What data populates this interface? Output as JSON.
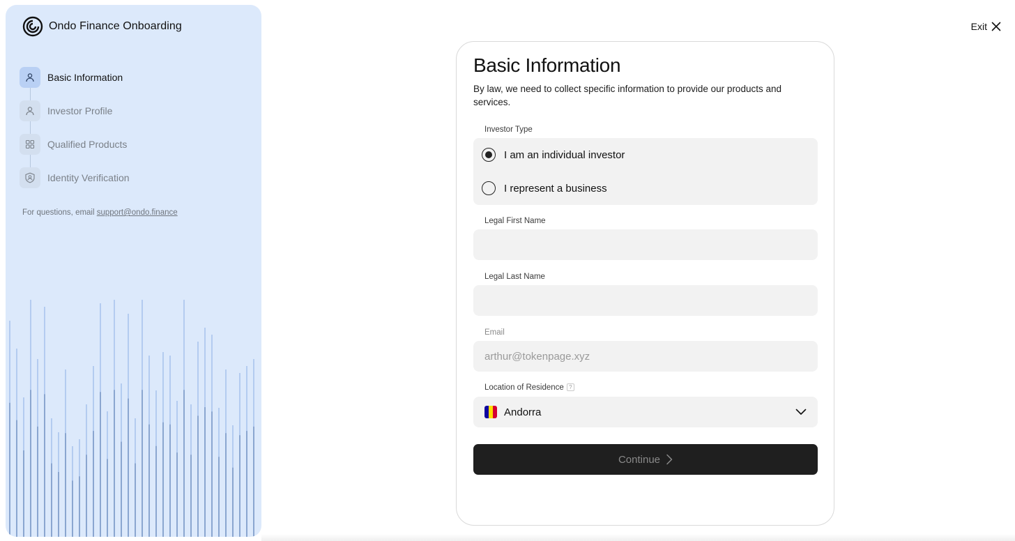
{
  "sidebar": {
    "brand_title": "Ondo Finance Onboarding",
    "steps": [
      {
        "label": "Basic Information",
        "icon": "user-icon",
        "active": true
      },
      {
        "label": "Investor Profile",
        "icon": "user-icon",
        "active": false
      },
      {
        "label": "Qualified Products",
        "icon": "grid-icon",
        "active": false
      },
      {
        "label": "Identity Verification",
        "icon": "shield-user-icon",
        "active": false
      }
    ],
    "help_text": "For questions, email ",
    "help_email": "support@ondo.finance"
  },
  "header": {
    "exit_label": "Exit"
  },
  "form": {
    "title": "Basic Information",
    "description": "By law, we need to collect specific information to provide our products and services.",
    "investor_type": {
      "label": "Investor Type",
      "options": [
        {
          "label": "I am an individual investor",
          "selected": true
        },
        {
          "label": "I represent a business",
          "selected": false
        }
      ]
    },
    "first_name": {
      "label": "Legal First Name",
      "value": ""
    },
    "last_name": {
      "label": "Legal Last Name",
      "value": ""
    },
    "email": {
      "label": "Email",
      "value": "arthur@tokenpage.xyz"
    },
    "residence": {
      "label": "Location of Residence",
      "help": "?",
      "value": "Andorra"
    },
    "continue_label": "Continue"
  },
  "colors": {
    "sidebar_bg": "#dce9fb",
    "button_bg": "#1f1f1f",
    "field_bg": "#f2f2f2"
  }
}
